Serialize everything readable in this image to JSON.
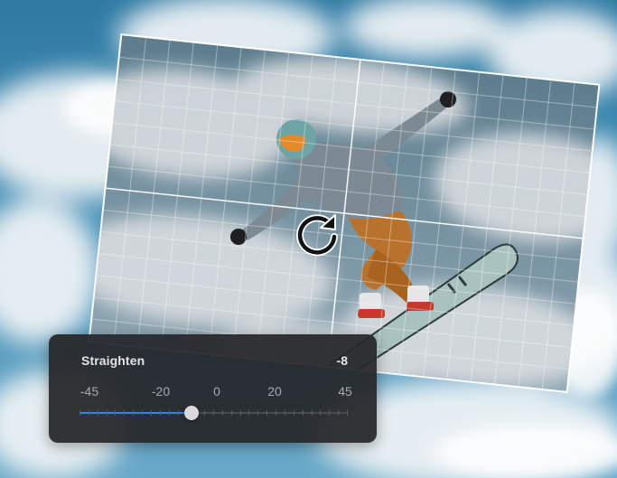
{
  "straighten": {
    "label": "Straighten",
    "value_label": "-8",
    "value": -8,
    "min": -45,
    "max": 45,
    "ticks": [
      "-45",
      "-20",
      "0",
      "20",
      "45"
    ]
  },
  "colors": {
    "accent": "#3b7ff2",
    "panel_bg": "#26272b",
    "thumb": "#d9d9de"
  },
  "icons": {
    "rotate": "rotate-clockwise-icon"
  }
}
